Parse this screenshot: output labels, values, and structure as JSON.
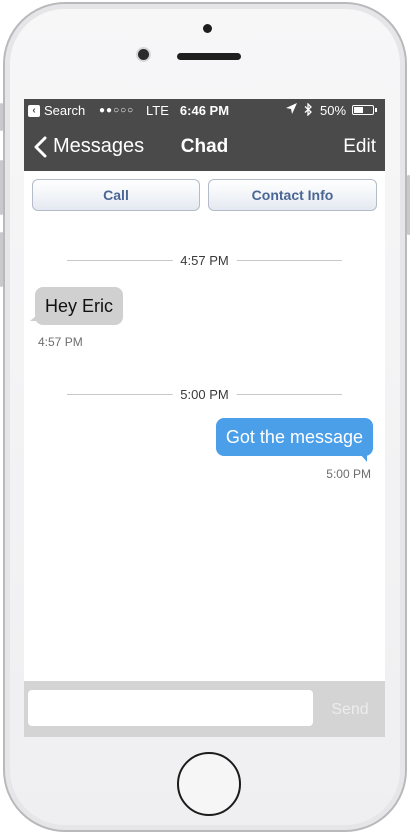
{
  "status_bar": {
    "back_app": "Search",
    "signal": "●●○○○",
    "network": "LTE",
    "time": "6:46 PM",
    "location_icon": "location-arrow-icon",
    "bluetooth_icon": "bluetooth-icon",
    "battery_percent": "50%",
    "battery_level": 0.5
  },
  "nav": {
    "back_label": "Messages",
    "title": "Chad",
    "edit_label": "Edit"
  },
  "actions": {
    "call_label": "Call",
    "contact_info_label": "Contact Info"
  },
  "messages": [
    {
      "divider_time": "4:57 PM",
      "direction": "incoming",
      "text": "Hey Eric",
      "time": "4:57 PM"
    },
    {
      "divider_time": "5:00 PM",
      "direction": "outgoing",
      "text": "Got the message",
      "time": "5:00 PM"
    }
  ],
  "compose": {
    "value": "",
    "placeholder": "",
    "send_label": "Send"
  },
  "colors": {
    "bar_background": "#4a4a4a",
    "incoming_bubble": "#d0d0d0",
    "outgoing_bubble": "#4a9fe8",
    "action_text": "#4a6694"
  }
}
